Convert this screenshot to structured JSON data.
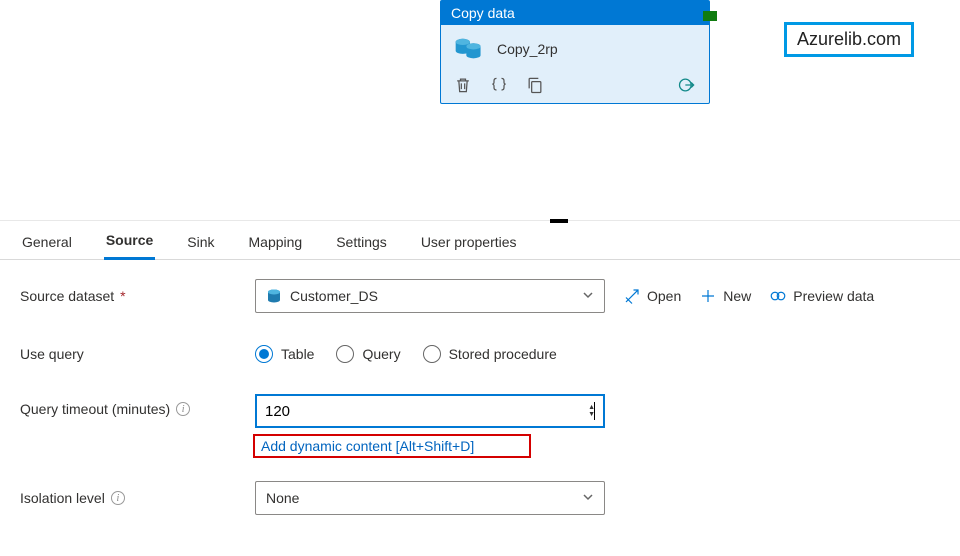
{
  "activity": {
    "header": "Copy data",
    "name": "Copy_2rp"
  },
  "watermark": "Azurelib.com",
  "tabs": {
    "general": "General",
    "source": "Source",
    "sink": "Sink",
    "mapping": "Mapping",
    "settings": "Settings",
    "user_properties": "User properties"
  },
  "form": {
    "source_dataset_label": "Source dataset",
    "source_dataset_value": "Customer_DS",
    "open_label": "Open",
    "new_label": "New",
    "preview_label": "Preview data",
    "use_query_label": "Use query",
    "radio_table": "Table",
    "radio_query": "Query",
    "radio_sp": "Stored procedure",
    "timeout_label": "Query timeout (minutes)",
    "timeout_value": "120",
    "dynamic_hint": "Add dynamic content [Alt+Shift+D]",
    "isolation_label": "Isolation level",
    "isolation_value": "None"
  }
}
